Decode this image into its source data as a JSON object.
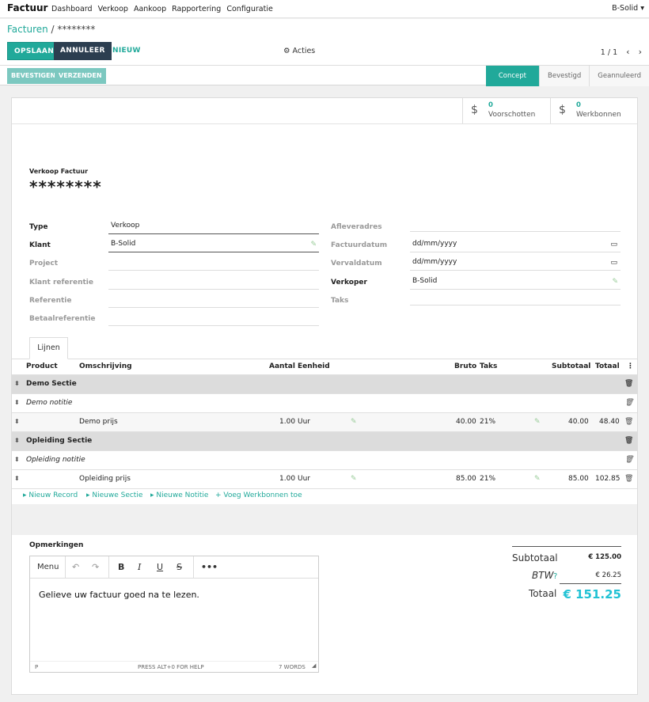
{
  "nav": {
    "brand": "Factuur",
    "menu": [
      "Dashboard",
      "Verkoop",
      "Aankoop",
      "Rapportering",
      "Configuratie"
    ],
    "company": "B-Solid ▾"
  },
  "breadcrumb": {
    "parent": "Facturen",
    "sep": " / ",
    "current": "********"
  },
  "toolbar": {
    "save": "OPSLAAN",
    "cancel": "ANNULEER",
    "new": "NIEUW",
    "actions": "Acties",
    "pager": "1 / 1",
    "prev": "‹",
    "next": "›"
  },
  "statusbar": {
    "confirm": "BEVESTIGEN",
    "send": "VERZENDEN",
    "stages": [
      "Concept",
      "Bevestigd",
      "Geannuleerd"
    ],
    "active_stage": "Concept"
  },
  "smart_buttons": [
    {
      "count": "0",
      "label": "Voorschotten",
      "icon": "dollar-icon"
    },
    {
      "count": "0",
      "label": "Werkbonnen",
      "icon": "dollar-icon"
    }
  ],
  "form": {
    "type_label": "Verkoop Factuur",
    "name": "********",
    "left": [
      {
        "label": "Type",
        "value": "Verkoop"
      },
      {
        "label": "Klant",
        "value": "B-Solid"
      },
      {
        "label": "Project",
        "value": ""
      },
      {
        "label": "Klant referentie",
        "value": ""
      },
      {
        "label": "Referentie",
        "value": ""
      },
      {
        "label": "Betaalreferentie",
        "value": ""
      }
    ],
    "right": [
      {
        "label": "Afleveradres",
        "value": ""
      },
      {
        "label": "Factuurdatum",
        "value": "dd/mm/yyyy"
      },
      {
        "label": "Vervaldatum",
        "value": "dd/mm/yyyy"
      },
      {
        "label": "Verkoper",
        "value": "B-Solid"
      },
      {
        "label": "Taks",
        "value": ""
      }
    ]
  },
  "tab": "Lijnen",
  "table": {
    "headers": {
      "product": "Product",
      "omschrijving": "Omschrijving",
      "aantal": "Aantal",
      "eenheid": "Eenheid",
      "bruto": "Bruto",
      "taks": "Taks",
      "subtotaal": "Subtotaal",
      "totaal": "Totaal",
      "more": "⋮"
    },
    "rows": [
      {
        "kind": "section",
        "text": "Demo Sectie"
      },
      {
        "kind": "note",
        "text": "Demo notitie"
      },
      {
        "kind": "line",
        "text": "Demo prijs",
        "aantal": "1.00",
        "eenheid": "Uur",
        "bruto": "40.00",
        "taks": "21%",
        "subtotaal": "40.00",
        "totaal": "48.40"
      },
      {
        "kind": "section",
        "text": "Opleiding Sectie"
      },
      {
        "kind": "note",
        "text": "Opleiding notitie"
      },
      {
        "kind": "line",
        "text": "Opleiding prijs",
        "aantal": "1.00",
        "eenheid": "Uur",
        "bruto": "85.00",
        "taks": "21%",
        "subtotaal": "85.00",
        "totaal": "102.85"
      }
    ],
    "actions": [
      "▸ Nieuw Record",
      "▸ Nieuwe Sectie",
      "▸ Nieuwe Notitie",
      "+ Voeg Werkbonnen toe"
    ]
  },
  "notes": {
    "label": "Opmerkingen",
    "menu": "Menu",
    "body": "Gelieve uw factuur goed na te lezen.",
    "footer_path": "P",
    "footer_help": "PRESS ALT+0 FOR HELP",
    "footer_words": "7 WORDS"
  },
  "totals": {
    "subtotal_label": "Subtotaal",
    "subtotal": "€ 125.00",
    "tax_label": "BTW",
    "tax_help": "?",
    "tax": "€ 26.25",
    "total_label": "Totaal",
    "total": "€ 151.25"
  }
}
